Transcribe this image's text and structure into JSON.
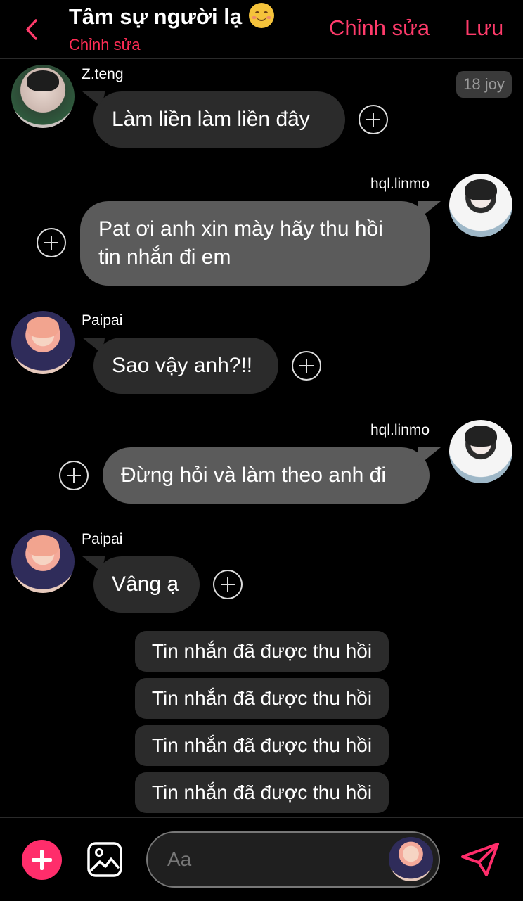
{
  "header": {
    "title": "Tâm sự người lạ",
    "title_emoji": "smiling-face-icon",
    "subtitle": "Chỉnh sửa",
    "edit_label": "Chỉnh sửa",
    "save_label": "Lưu",
    "accent_color": "#ff3b6b"
  },
  "timestamp": "18 joy",
  "messages": [
    {
      "sender": "Z.teng",
      "text": "Làm liền làm liền đây",
      "side": "left"
    },
    {
      "sender": "hql.linmo",
      "text_line1": "Pat ơi anh xin mày hãy thu hồi",
      "text_line2": "tin nhắn đi em",
      "side": "right"
    },
    {
      "sender": "Paipai",
      "text": "Sao vậy anh?!!",
      "side": "left"
    },
    {
      "sender": "hql.linmo",
      "text": "Đừng hỏi và làm theo anh đi",
      "side": "right"
    },
    {
      "sender": "Paipai",
      "text": "Vâng ạ",
      "side": "left"
    }
  ],
  "recalled": [
    "Tin nhắn đã được thu hồi",
    "Tin nhắn đã được thu hồi",
    "Tin nhắn đã được thu hồi",
    "Tin nhắn đã được thu hồi"
  ],
  "composer": {
    "placeholder": "Aa",
    "add_icon": "plus-icon",
    "gallery_icon": "image-icon",
    "send_icon": "send-icon"
  }
}
